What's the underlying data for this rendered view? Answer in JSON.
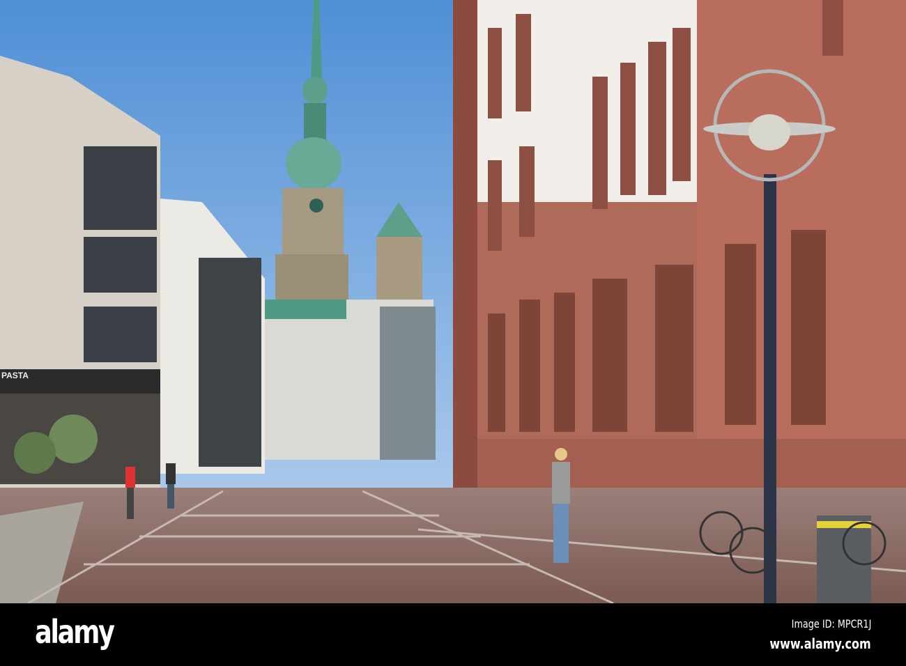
{
  "photo": {
    "shop_sign": "PASTA",
    "colors": {
      "sky": "#5b97d8",
      "sandstone": "#b06a5a",
      "pavement": "#8a6a60",
      "copper": "#5e9f8c"
    }
  },
  "footer": {
    "logo": "alamy",
    "image_id": "Image ID: MPCR1J",
    "website": "www.alamy.com"
  }
}
